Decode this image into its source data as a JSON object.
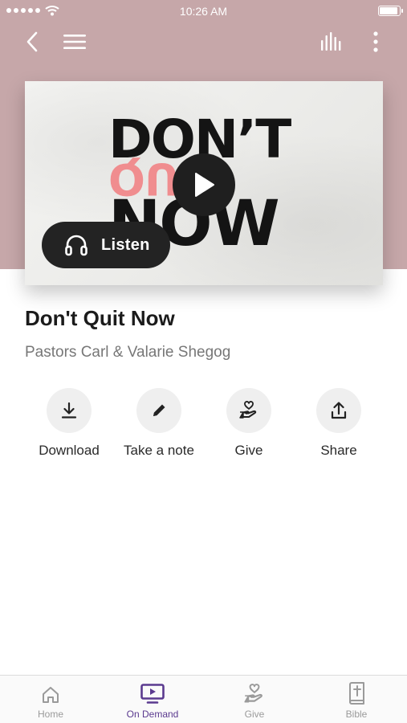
{
  "status_bar": {
    "time": "10:26 AM"
  },
  "nav": {
    "back_icon": "chevron-left-icon",
    "menu_icon": "hamburger-icon",
    "audio_icon": "audio-bars-icon",
    "more_icon": "more-vertical-icon"
  },
  "artwork": {
    "line1": "DON’T",
    "line2": "QUIT",
    "line3": "NOW",
    "accent_color": "#f08d8f"
  },
  "listen_button": {
    "label": "Listen",
    "icon": "headphones-icon"
  },
  "sermon": {
    "title": "Don't Quit Now",
    "speakers": "Pastors Carl & Valarie Shegog"
  },
  "actions": [
    {
      "label": "Download",
      "icon": "download-icon"
    },
    {
      "label": "Take a note",
      "icon": "pencil-icon"
    },
    {
      "label": "Give",
      "icon": "give-hand-heart-icon"
    },
    {
      "label": "Share",
      "icon": "share-icon"
    }
  ],
  "tabs": [
    {
      "label": "Home",
      "icon": "home-icon",
      "active": false
    },
    {
      "label": "On Demand",
      "icon": "tv-play-icon",
      "active": true
    },
    {
      "label": "Give",
      "icon": "give-hand-heart-icon",
      "active": false
    },
    {
      "label": "Bible",
      "icon": "bible-icon",
      "active": false
    }
  ],
  "colors": {
    "hero_background": "#c6a7a9",
    "active_tab": "#5b3a8f",
    "dark_button": "#232323"
  }
}
